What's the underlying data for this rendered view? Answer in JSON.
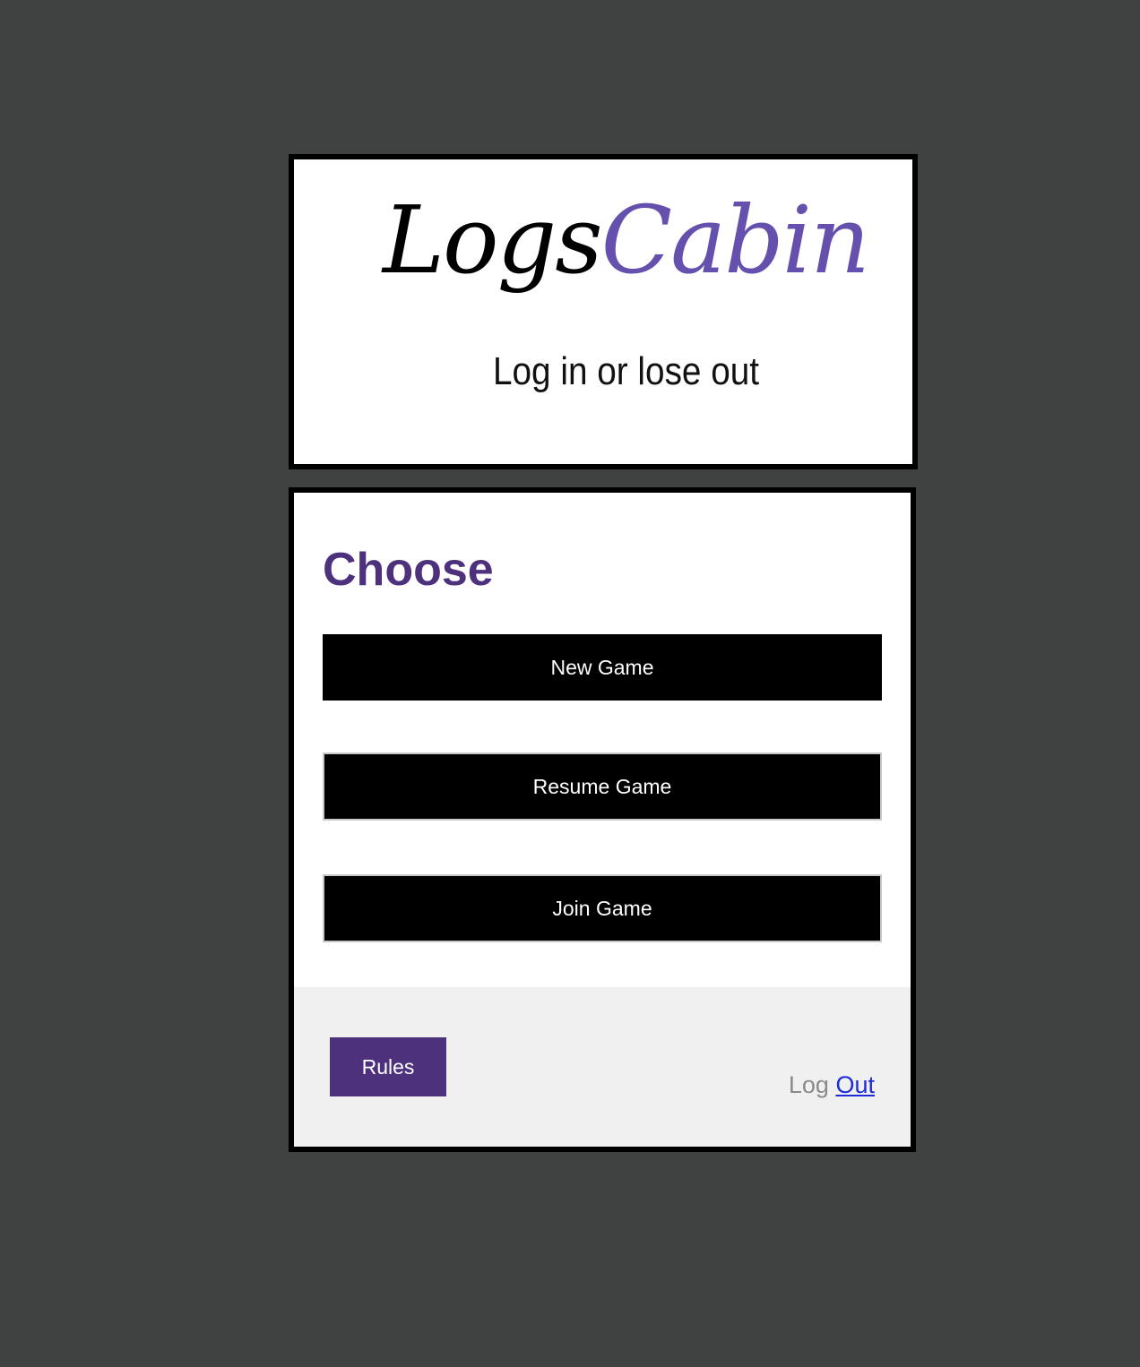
{
  "logo": {
    "word1": "Logs",
    "word2": "Cabin",
    "tagline": "Log in or lose out"
  },
  "choose": {
    "title": "Choose",
    "buttons": [
      {
        "label": "New Game"
      },
      {
        "label": "Resume Game"
      },
      {
        "label": "Join Game"
      }
    ]
  },
  "footer": {
    "rules_label": "Rules",
    "logout_prefix": "Log",
    "logout_link": "Out"
  },
  "colors": {
    "page_background": "#404141",
    "brand_purple": "#4e317d",
    "logo_purple": "#6550ad",
    "button_black": "#000000",
    "footer_background": "#f0f0f0",
    "link_blue": "#1d2bd8"
  }
}
